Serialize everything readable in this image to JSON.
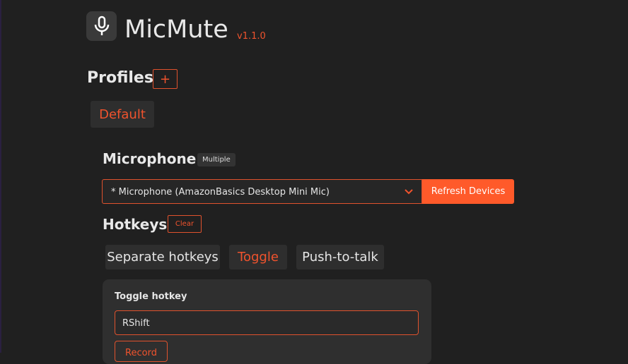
{
  "app": {
    "title": "MicMute",
    "version": "v1.1.0"
  },
  "profiles": {
    "heading": "Profiles",
    "add_label": "+",
    "items": [
      {
        "label": "Default"
      }
    ]
  },
  "microphone": {
    "heading": "Microphone",
    "badge": "Multiple",
    "selected": "* Microphone (AmazonBasics Desktop Mini Mic)",
    "refresh_label": "Refresh Devices"
  },
  "hotkeys": {
    "heading": "Hotkeys",
    "clear_label": "Clear",
    "modes": [
      {
        "label": "Separate hotkeys"
      },
      {
        "label": "Toggle"
      },
      {
        "label": "Push-to-talk"
      }
    ],
    "toggle_label": "Toggle hotkey",
    "toggle_value": "RShift",
    "record_label": "Record"
  },
  "colors": {
    "accent": "#ff5a2a",
    "background": "#202020"
  }
}
